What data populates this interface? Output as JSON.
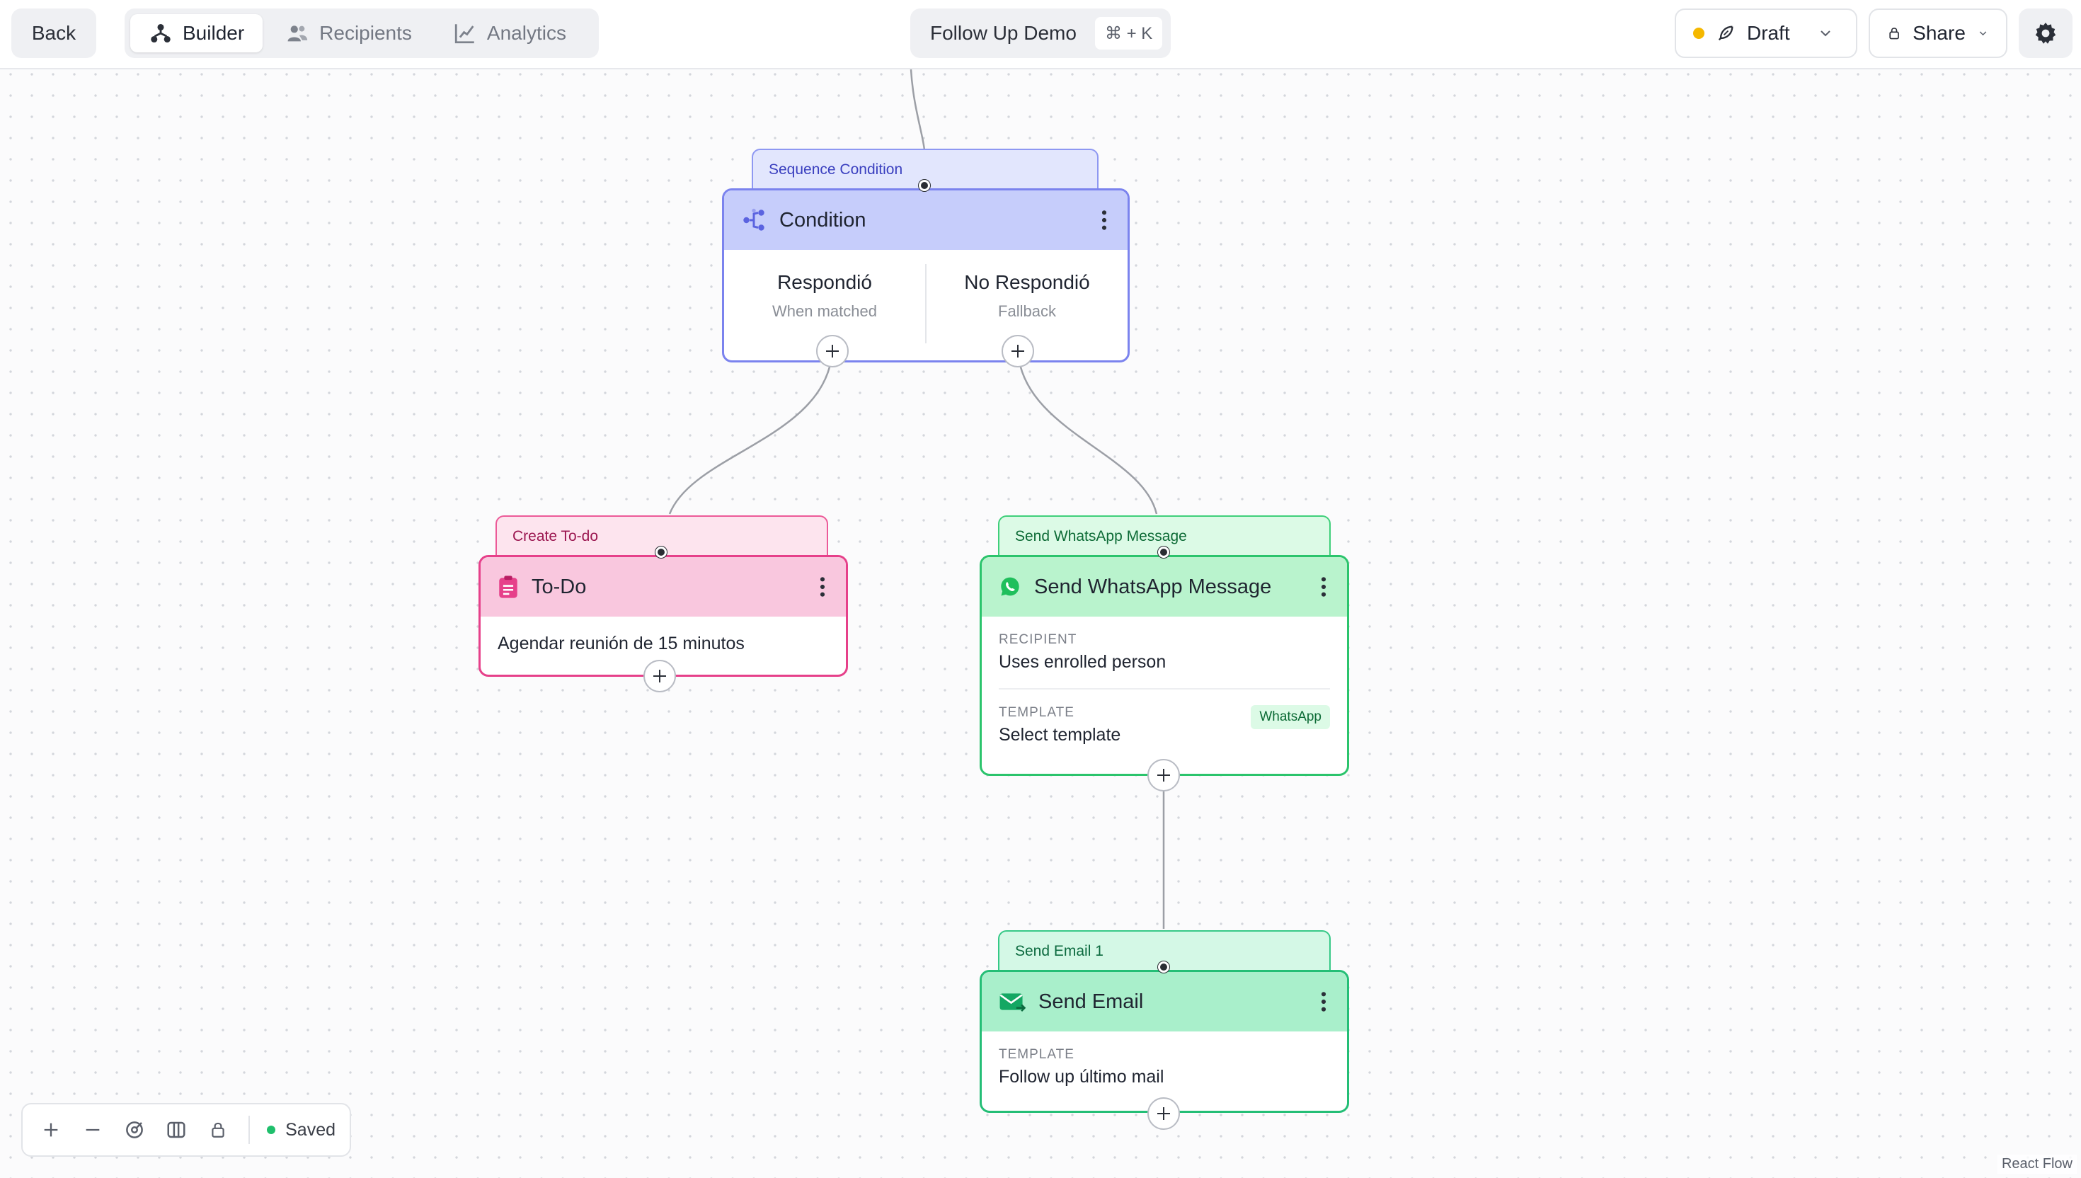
{
  "header": {
    "back_label": "Back",
    "tabs": [
      {
        "label": "Builder",
        "icon": "hierarchy-icon",
        "active": true
      },
      {
        "label": "Recipients",
        "icon": "users-icon",
        "active": false
      },
      {
        "label": "Analytics",
        "icon": "chart-icon",
        "active": false
      }
    ],
    "title": "Follow Up Demo",
    "shortcut": "⌘ + K",
    "status_label": "Draft",
    "share_label": "Share"
  },
  "nodes": {
    "condition": {
      "tag": "Sequence Condition",
      "title": "Condition",
      "branches": [
        {
          "title": "Respondió",
          "subtitle": "When matched"
        },
        {
          "title": "No Respondió",
          "subtitle": "Fallback"
        }
      ]
    },
    "todo": {
      "tag": "Create To-do",
      "title": "To-Do",
      "text": "Agendar reunión de 15 minutos"
    },
    "whatsapp": {
      "tag": "Send WhatsApp Message",
      "title": "Send WhatsApp Message",
      "recipient_label": "RECIPIENT",
      "recipient_value": "Uses enrolled person",
      "template_label": "TEMPLATE",
      "template_value": "Select template",
      "badge": "WhatsApp"
    },
    "email": {
      "tag": "Send Email 1",
      "title": "Send Email",
      "template_label": "TEMPLATE",
      "template_value": "Follow up último mail"
    }
  },
  "footer": {
    "saved_label": "Saved",
    "attribution": "React Flow"
  },
  "colors": {
    "condition": "#7b83ee",
    "todo": "#e6408a",
    "whatsapp": "#2bc46c",
    "email": "#24be76",
    "draft_dot": "#f5b800",
    "saved_dot": "#1fbf6c"
  }
}
